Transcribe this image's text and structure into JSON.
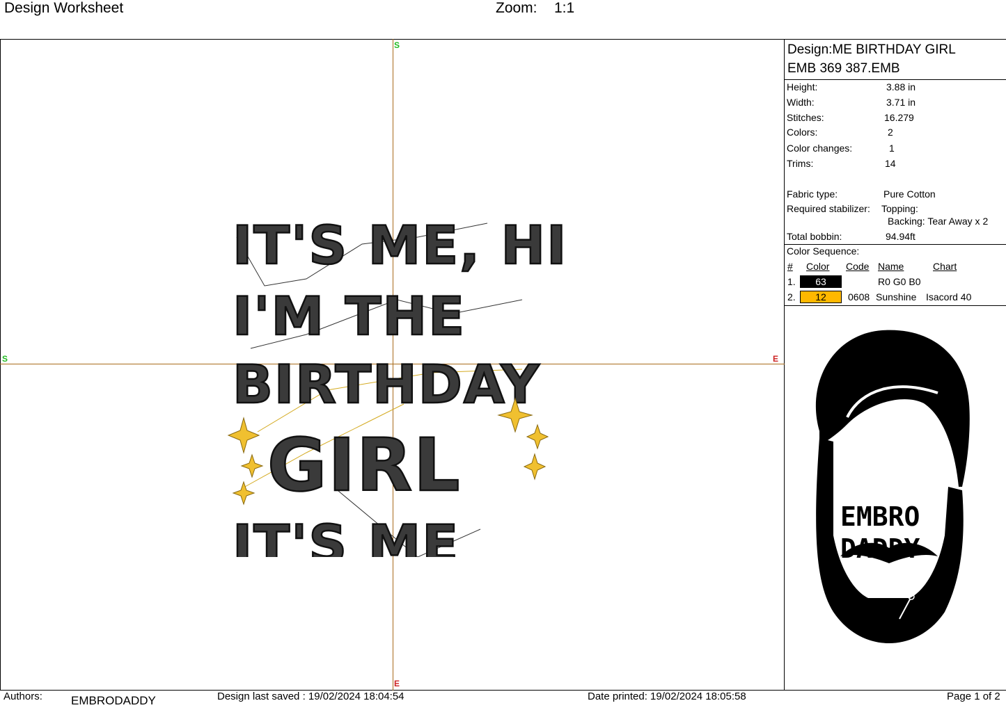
{
  "header": {
    "title": "Design Worksheet",
    "zoom_label": "Zoom:",
    "zoom_value": "1:1"
  },
  "canvas": {
    "axis_labels": {
      "top": "S",
      "left": "S",
      "right": "E",
      "bottom": "E"
    },
    "design_lines": [
      "IT'S ME, HI",
      "I'M THE",
      "BIRTHDAY",
      "GIRL",
      "IT'S ME"
    ],
    "colors": {
      "thread_black": "#3a3a3a",
      "thread_yellow": "#f0c030",
      "axis": "#a86a1a"
    }
  },
  "panel": {
    "design_line1": "Design:ME BIRTHDAY GIRL",
    "design_line2": "EMB 369 387.EMB",
    "stats": [
      {
        "label": "Height:",
        "value": "3.88 in"
      },
      {
        "label": "Width:",
        "value": "3.71 in"
      },
      {
        "label": "Stitches:",
        "value": "16.279"
      },
      {
        "label": "Colors:",
        "value": "2"
      },
      {
        "label": "Color changes:",
        "value": "1"
      },
      {
        "label": "Trims:",
        "value": "14"
      }
    ],
    "fabric": {
      "label": "Fabric type:",
      "value": "Pure Cotton"
    },
    "stabilizer": {
      "label": "Required stabilizer:",
      "topping": "Topping:",
      "backing": "Backing: Tear Away x 2"
    },
    "bobbin": {
      "label": "Total bobbin:",
      "value": "94.94ft"
    },
    "color_sequence": {
      "title": "Color Sequence:",
      "headers": {
        "num": "#",
        "color": "Color",
        "code": "Code",
        "name": "Name",
        "chart": "Chart"
      },
      "rows": [
        {
          "num": "1.",
          "color": "63",
          "swatch": "#000000",
          "text_color": "#ffffff",
          "code": "",
          "name": "R0 G0 B0",
          "chart": ""
        },
        {
          "num": "2.",
          "color": "12",
          "swatch": "#ffb800",
          "text_color": "#000000",
          "code": "0608",
          "name": "Sunshine",
          "chart": "Isacord 40"
        }
      ]
    },
    "logo": {
      "line1": "EMBRO",
      "line2": "DADDY"
    }
  },
  "footer": {
    "authors_label": "Authors:",
    "authors_value": "EMBRODADDY",
    "saved": "Design last saved : 19/02/2024 18:04:54",
    "printed": "Date printed: 19/02/2024 18:05:58",
    "page": "Page 1 of 2"
  }
}
